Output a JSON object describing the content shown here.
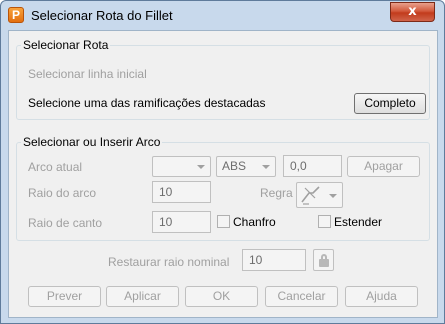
{
  "window": {
    "title": "Selecionar Rota do Fillet",
    "close_glyph": "x"
  },
  "route_group": {
    "title": "Selecionar Rota",
    "initial_line": "Selecionar linha inicial",
    "instruction": "Selecione uma das ramificações destacadas",
    "complete_button": "Completo"
  },
  "arc_group": {
    "title": "Selecionar ou Inserir Arco",
    "current_arc_label": "Arco atual",
    "current_arc_value": "",
    "abs_option": "ABS",
    "offset_value": "0,0",
    "delete_button": "Apagar",
    "arc_radius_label": "Raio do arco",
    "arc_radius_value": "10",
    "rule_label": "Regra",
    "corner_radius_label": "Raio de canto",
    "corner_radius_value": "10",
    "chamfer_label": "Chanfro",
    "extend_label": "Estender"
  },
  "restore": {
    "label": "Restaurar raio nominal",
    "value": "10"
  },
  "footer": {
    "preview": "Prever",
    "apply": "Aplicar",
    "ok": "OK",
    "cancel": "Cancelar",
    "help": "Ajuda"
  }
}
